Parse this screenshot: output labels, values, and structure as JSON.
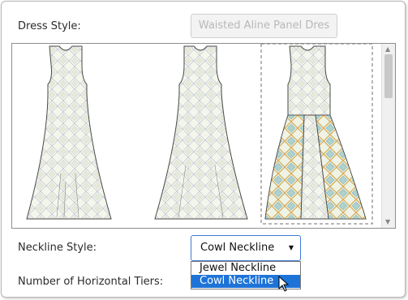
{
  "dress_style": {
    "label": "Dress Style:",
    "value": "Waisted Aline Panel Dres"
  },
  "gallery": {
    "items": [
      {
        "icon": "dress-plain-icon",
        "selected": false
      },
      {
        "icon": "dress-plain-icon",
        "selected": false
      },
      {
        "icon": "dress-panel-icon",
        "selected": true
      }
    ]
  },
  "neckline": {
    "label": "Neckline Style:",
    "selected": "Cowl Neckline",
    "options": [
      "Jewel Neckline",
      "Cowl Neckline"
    ],
    "highlighted_option": "Cowl Neckline"
  },
  "tiers": {
    "label": "Number of Horizontal Tiers:"
  },
  "colors": {
    "accent": "#1e73d8",
    "select_border": "#3d7bd8"
  }
}
